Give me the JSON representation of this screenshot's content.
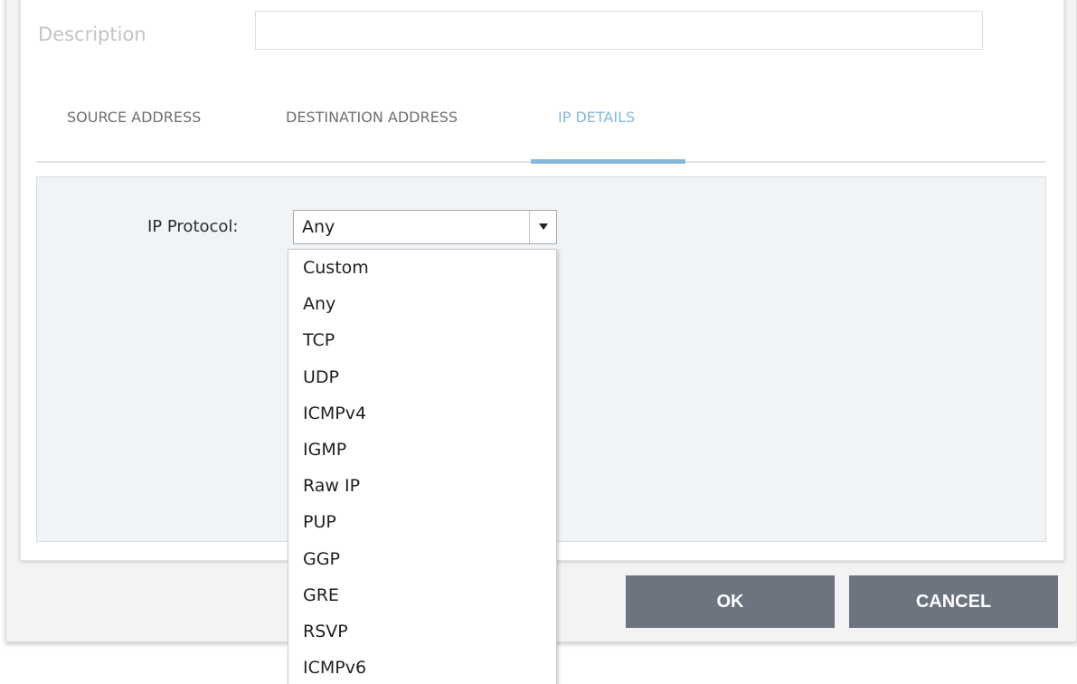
{
  "form": {
    "description_label": "Description",
    "description_value": ""
  },
  "tabs": [
    {
      "label": "SOURCE ADDRESS",
      "active": false
    },
    {
      "label": "DESTINATION ADDRESS",
      "active": false
    },
    {
      "label": "IP DETAILS",
      "active": true
    }
  ],
  "ip_details": {
    "protocol_label": "IP Protocol:",
    "protocol_selected": "Any",
    "protocol_options": [
      "Custom",
      "Any",
      "TCP",
      "UDP",
      "ICMPv4",
      "IGMP",
      "Raw IP",
      "PUP",
      "GGP",
      "GRE",
      "RSVP",
      "ICMPv6"
    ]
  },
  "buttons": {
    "ok_label": "OK",
    "cancel_label": "CANCEL"
  },
  "colors": {
    "active_tab": "#86b8dc",
    "button_bg": "#6c7480",
    "content_bg": "#f0f4f7"
  }
}
